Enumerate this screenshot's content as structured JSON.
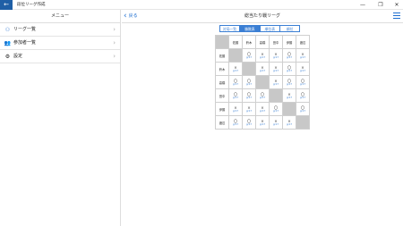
{
  "window": {
    "title": "段位リーグ作成",
    "back_glyph": "←",
    "min_glyph": "—",
    "max_glyph": "❐",
    "close_glyph": "✕"
  },
  "sidebar": {
    "header": "メニュー",
    "items": [
      {
        "label": "リーグ一覧",
        "icon": "sitemap-icon",
        "glyph": "⚇"
      },
      {
        "label": "参加者一覧",
        "icon": "people-icon",
        "glyph": "👥"
      },
      {
        "label": "設定",
        "icon": "gear-icon",
        "glyph": "⚙"
      }
    ]
  },
  "main": {
    "back_label": "戻る",
    "title": "総当たり戦リーグ",
    "segments": [
      "対局一覧",
      "勝敗表",
      "順位表",
      "順位"
    ],
    "active_segment": 1,
    "players": [
      "佐藤",
      "鈴木",
      "高橋",
      "田中",
      "伊藤",
      "渡辺"
    ],
    "matrix": [
      [
        "",
        "〇",
        "×",
        "×",
        "〇",
        "×"
      ],
      [
        "×",
        "",
        "×",
        "×",
        "〇",
        "×"
      ],
      [
        "〇",
        "〇",
        "",
        "×",
        "〇",
        "〇"
      ],
      [
        "〇",
        "〇",
        "〇",
        "",
        "×",
        "〇"
      ],
      [
        "×",
        "×",
        "×",
        "〇",
        "",
        "〇"
      ],
      [
        "〇",
        "〇",
        "×",
        "×",
        "×",
        ""
      ]
    ],
    "cell_link": "gr17"
  },
  "colors": {
    "accent": "#3b7fd4",
    "titlebar_back": "#1f5fa6",
    "diag": "#c8c8c8"
  }
}
